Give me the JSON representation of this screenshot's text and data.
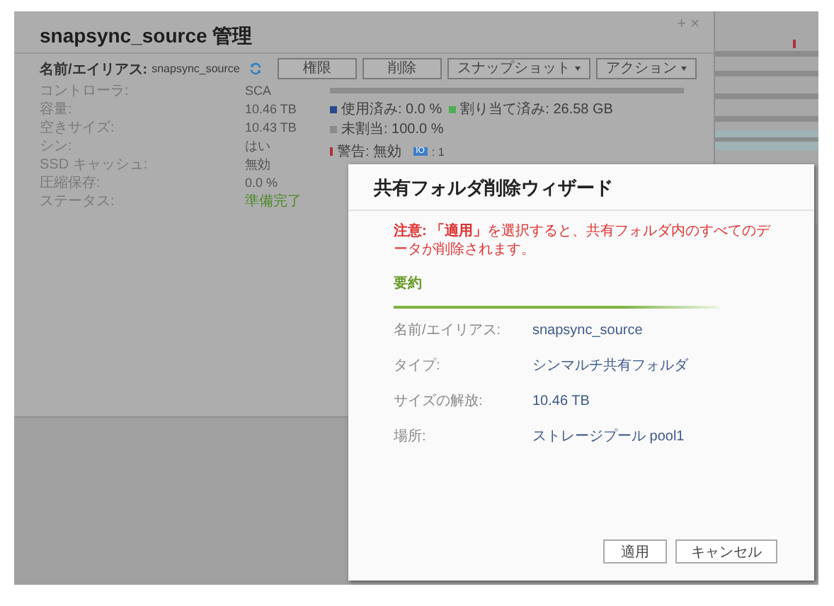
{
  "window": {
    "title": "snapsync_source 管理",
    "controls": [
      "+",
      "×"
    ]
  },
  "name_alias": {
    "label": "名前/エイリアス:",
    "value": "snapsync_source"
  },
  "toolbar": [
    {
      "label": "権限",
      "kind": "plain"
    },
    {
      "label": "削除",
      "kind": "plain"
    },
    {
      "label": "スナップショット",
      "kind": "dropdown"
    },
    {
      "label": "アクション",
      "kind": "dropdown"
    }
  ],
  "properties": [
    {
      "label": "コントローラ:",
      "value": "SCA",
      "kind": "plain"
    },
    {
      "label": "容量:",
      "value": "10.46 TB",
      "kind": "plain"
    },
    {
      "label": "空きサイズ:",
      "value": "10.43 TB",
      "kind": "plain"
    },
    {
      "label": "シン:",
      "value": "はい",
      "kind": "plain"
    },
    {
      "label": "SSD キャッシュ:",
      "value": "無効",
      "kind": "plain"
    },
    {
      "label": "圧縮保存:",
      "value": "0.0 %",
      "kind": "plain"
    },
    {
      "label": "ステータス:",
      "value": "準備完了",
      "kind": "status"
    }
  ],
  "usage": {
    "level": 0.0,
    "legend": [
      {
        "label": "使用済み: 0.0 %",
        "color": "#2b4a8c"
      },
      {
        "label": "割り当て済み: 26.58 GB",
        "color": "#4caf50"
      },
      {
        "label": "未割当: 100.0 %",
        "color": "#8a8a8a"
      }
    ],
    "warning": "警告: 無効",
    "io_badge": "IO",
    "io_count": ": 1"
  },
  "dialog": {
    "title": "共有フォルダ削除ウィザード",
    "notice": "**注意:** **「適用」**を選択すると、共有フォルダ内のすべてのデータが削除されます。",
    "section": "要約",
    "rows": [
      {
        "label": "名前/エイリアス:",
        "value": "snapsync_source"
      },
      {
        "label": "タイプ:",
        "value": "シンマルチ共有フォルダ"
      },
      {
        "label": "サイズの解放:",
        "value": "10.46 TB"
      },
      {
        "label": "場所:",
        "value": "ストレージプール pool1"
      }
    ],
    "buttons": [
      "適用",
      "キャンセル"
    ]
  }
}
